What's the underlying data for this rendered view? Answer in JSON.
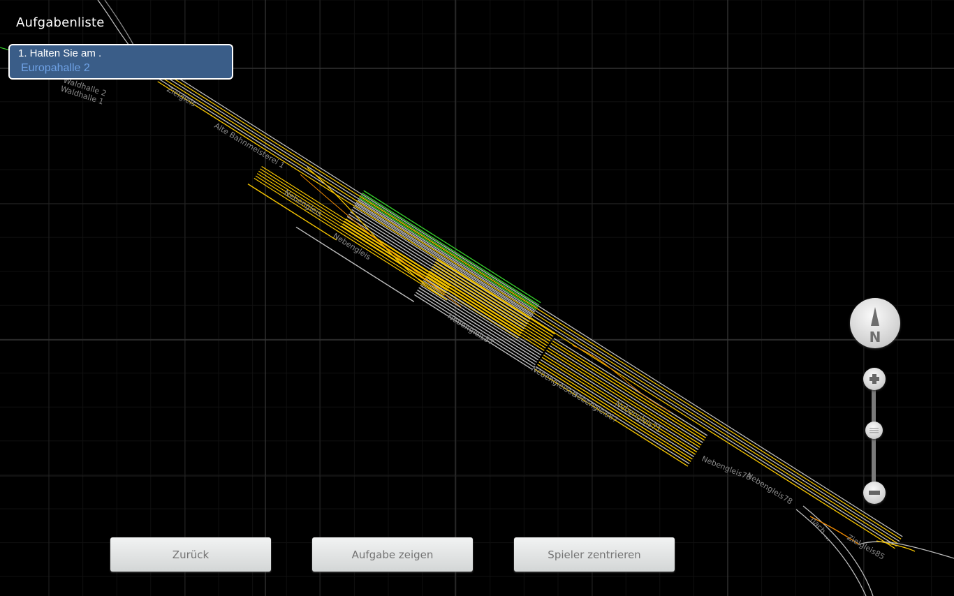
{
  "task_list": {
    "title": "Aufgabenliste",
    "tasks": [
      {
        "line1": "1. Halten Sie am .",
        "line2": "Europahalle 2"
      }
    ]
  },
  "buttons": {
    "back": "Zurück",
    "show_task": "Aufgabe zeigen",
    "center_player": "Spieler zentrieren"
  },
  "compass": {
    "label": "N",
    "icon": "compass-north-icon"
  },
  "zoom": {
    "plus_icon": "zoom-in-icon",
    "minus_icon": "zoom-out-icon",
    "level": 0.55
  },
  "map_labels": [
    "Waldhalle 2",
    "Waldhalle 1",
    "Zielgleis",
    "Alte Bahnmeisterei 1",
    "Nebengleis",
    "Nebengleis",
    "Nebengleis57",
    "Nebengleis60",
    "Nebengleis67",
    "Nebengleis71",
    "Nebengleis78",
    "Nebengleis78",
    "nach ...",
    "Zielgleis85"
  ],
  "colors": {
    "track_gray": "#bdbdbd",
    "track_yellow": "#f5c400",
    "track_orange": "#f08a00",
    "track_green": "#35c82a",
    "card": "#3a5d88",
    "card_text2": "#6fa2e6"
  }
}
